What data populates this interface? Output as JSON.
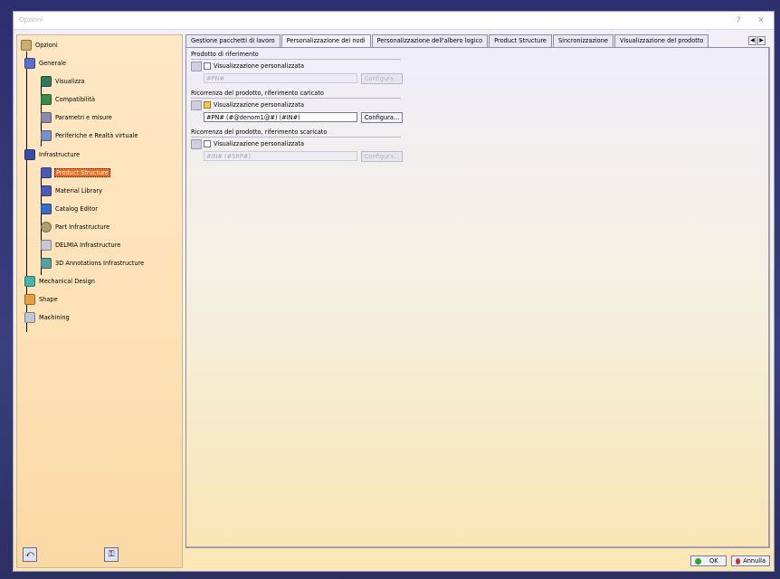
{
  "window": {
    "title": "Opzioni",
    "help_label": "?",
    "close_label": "✕"
  },
  "tree": {
    "root": {
      "label": "Opzioni",
      "icon": "options-root-icon"
    },
    "nodes": [
      {
        "label": "Generale",
        "icon": "general-icon",
        "level": 1,
        "selected": false
      },
      {
        "label": "Visualizza",
        "icon": "display-icon",
        "level": 2,
        "selected": false
      },
      {
        "label": "Compatibilità",
        "icon": "compatibility-icon",
        "level": 2,
        "selected": false
      },
      {
        "label": "Parametri e misure",
        "icon": "parameters-icon",
        "level": 2,
        "selected": false
      },
      {
        "label": "Periferiche e Realtà virtuale",
        "icon": "devices-icon",
        "level": 2,
        "selected": false
      },
      {
        "label": "Infrastructure",
        "icon": "infrastructure-icon",
        "level": 1,
        "selected": false
      },
      {
        "label": "Product Structure",
        "icon": "product-structure-icon",
        "level": 2,
        "selected": true
      },
      {
        "label": "Material Library",
        "icon": "material-library-icon",
        "level": 2,
        "selected": false
      },
      {
        "label": "Catalog Editor",
        "icon": "catalog-editor-icon",
        "level": 2,
        "selected": false
      },
      {
        "label": "Part Infrastructure",
        "icon": "part-infrastructure-icon",
        "level": 2,
        "selected": false
      },
      {
        "label": "DELMIA Infrastructure",
        "icon": "delmia-icon",
        "level": 2,
        "selected": false
      },
      {
        "label": "3D Annotations Infrastructure",
        "icon": "annotations-icon",
        "level": 2,
        "selected": false
      },
      {
        "label": "Mechanical Design",
        "icon": "mechanical-design-icon",
        "level": 1,
        "selected": false
      },
      {
        "label": "Shape",
        "icon": "shape-icon",
        "level": 1,
        "selected": false
      },
      {
        "label": "Machining",
        "icon": "machining-icon",
        "level": 1,
        "selected": false
      }
    ],
    "bottom_icons": [
      "reset-options-icon",
      "lock-options-icon"
    ]
  },
  "tabs": [
    {
      "label": "Gestione pacchetti di lavoro",
      "active": false
    },
    {
      "label": "Personalizzazione dei nodi",
      "active": true
    },
    {
      "label": "Personalizzazione dell'albero logico",
      "active": false
    },
    {
      "label": "Product Structure",
      "active": false
    },
    {
      "label": "Sincronizzazione",
      "active": false
    },
    {
      "label": "Visualizzazione del prodotto",
      "active": false
    }
  ],
  "tab_scroll": {
    "left": "◀",
    "right": "▶"
  },
  "sections": [
    {
      "title": "Prodotto di riferimento",
      "checkbox_label": "Visualizzazione personalizzata",
      "checked": false,
      "field_value": "#PN#",
      "field_enabled": false,
      "button_label": "Configura...",
      "button_enabled": false
    },
    {
      "title": "Ricorrenza del prodotto, riferimento caricato",
      "checkbox_label": "Visualizzazione personalizzata",
      "checked": true,
      "field_value": "#PN#  (#@denom1@#)  (#IN#)",
      "field_enabled": true,
      "button_label": "Configura...",
      "button_enabled": true
    },
    {
      "title": "Ricorrenza del prodotto, riferimento scaricato",
      "checkbox_label": "Visualizzazione personalizzata",
      "checked": false,
      "field_value": "#IN# (#SRP#)",
      "field_enabled": false,
      "button_label": "Configura...",
      "button_enabled": false
    }
  ],
  "footer": {
    "ok_label": "OK",
    "cancel_label": "Annulla"
  },
  "colors": {
    "selection": "#f26a1b",
    "ok_dot": "#2aa52a",
    "cancel_dot": "#d03030"
  }
}
